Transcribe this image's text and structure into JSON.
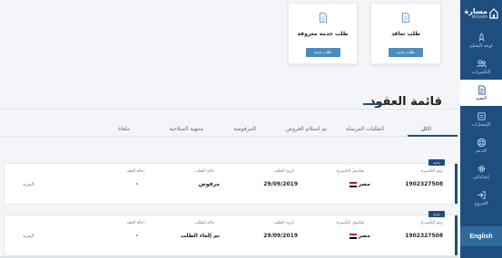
{
  "sidebar": {
    "brand_name": "مسارة",
    "brand_sub": "MUSARA",
    "items": [
      {
        "label": "لوحة التحكم",
        "icon": "rocket-icon",
        "active": false
      },
      {
        "label": "التأشيرات",
        "icon": "users-icon",
        "active": false
      },
      {
        "label": "العقود",
        "icon": "document-icon",
        "active": true
      },
      {
        "label": "الإشعارات",
        "icon": "bell-icon",
        "active": false
      },
      {
        "label": "الدعم",
        "icon": "lifebuoy-icon",
        "active": false
      },
      {
        "label": "إعداداتي",
        "icon": "gear-icon",
        "active": false
      },
      {
        "label": "الخروج",
        "icon": "logout-icon",
        "active": false
      }
    ],
    "language_button": "English"
  },
  "services": {
    "contract_request": {
      "title": "طلب تعاقد",
      "button": "طلب جديد"
    },
    "known_service": {
      "title": "طلب خدمة معروفة",
      "button": "طلب جديد"
    }
  },
  "section_title": "قائمة العقود",
  "tabs": [
    "الكل",
    "الطلبات المرسلة",
    "تم استلام العروض",
    "المرفوضة",
    "منتهية الصلاحية",
    "ملغاة"
  ],
  "columns": {
    "visa_number": "رقم التأشيرة",
    "visa_details": "تفاصيل التأشيرة",
    "request_date": "تاريخ الطلب",
    "request_status": "حالة الطلب",
    "contract_status": "حالة العقد:"
  },
  "contracts": [
    {
      "badge": "جديد",
      "visa_number": "1902327508",
      "visa_details": "مصر",
      "request_date": "29/09/2019",
      "request_status": "مرفوض",
      "contract_status": "-",
      "more": "المزيد"
    },
    {
      "badge": "جديد",
      "visa_number": "1902327508",
      "visa_details": "مصر",
      "request_date": "29/09/2019",
      "request_status": "تم إلغاء الطلب",
      "contract_status": "-",
      "more": "المزيد"
    }
  ],
  "colors": {
    "sidebar": "#1e4e7d",
    "button": "#4a8cc0",
    "link": "#3a86c3"
  }
}
